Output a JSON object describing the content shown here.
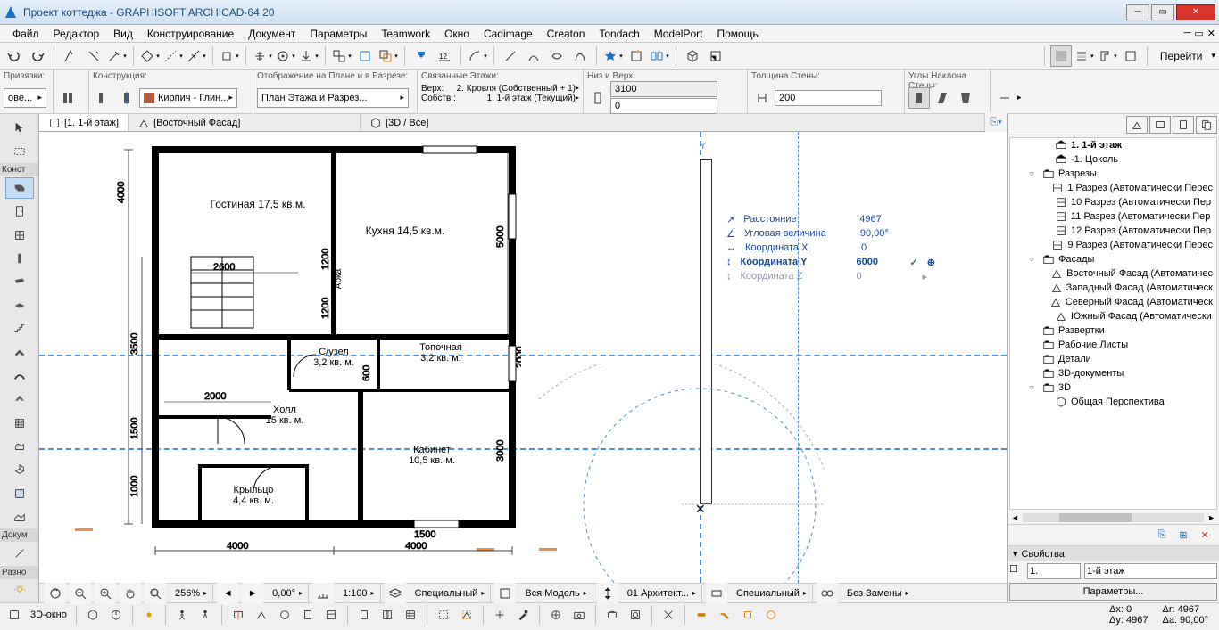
{
  "title": "Проект коттеджа - GRAPHISOFT ARCHICAD-64 20",
  "menus": [
    "Файл",
    "Редактор",
    "Вид",
    "Конструирование",
    "Документ",
    "Параметры",
    "Teamwork",
    "Окно",
    "Cadimage",
    "Creaton",
    "Tondach",
    "ModelPort",
    "Помощь"
  ],
  "nav_link": "Перейти",
  "infobox": {
    "snaps": {
      "label": "Привязки:",
      "value": "ове..."
    },
    "construction": {
      "label": "Конструкция:",
      "value": "Кирпич - Глин..."
    },
    "display": {
      "label": "Отображение на Плане и в Разрезе:",
      "value": "План Этажа и Разрез..."
    },
    "linked_stories": {
      "label": "Связанные Этажи:",
      "top": "Верх:",
      "top_val": "2. Кровля (Собственный + 1)",
      "own": "Собств.:",
      "own_val": "1. 1-й этаж (Текущий)"
    },
    "top_bottom": {
      "label": "Низ и Верх:",
      "top": "3100",
      "bottom": "0"
    },
    "thickness": {
      "label": "Толщина Стены:",
      "value": "200"
    },
    "angles": {
      "label": "Углы Наклона Стены:"
    }
  },
  "tabs": [
    {
      "label": "[1. 1-й этаж]",
      "active": true
    },
    {
      "label": "[Восточный Фасад]",
      "active": false
    },
    {
      "label": "[3D / Все]",
      "active": false
    }
  ],
  "tracker": {
    "distance": {
      "label": "Расстояние",
      "value": "4967"
    },
    "angle": {
      "label": "Угловая величина",
      "value": "90,00°"
    },
    "x": {
      "label": "Координата X",
      "value": "0"
    },
    "y": {
      "label": "Координата Y",
      "value": "6000"
    },
    "z": {
      "label": "Координата Z",
      "value": "0"
    }
  },
  "plan": {
    "rooms": {
      "living": "Гостиная 17,5 кв.м.",
      "kitchen": "Кухня 14,5 кв.м.",
      "arch": "Арка",
      "bath": "С/узел\n3,2 кв. м.",
      "boiler": "Топочная\n3,2 кв. м.",
      "hall": "Холл\n15 кв. м.",
      "office": "Кабинет\n10,5 кв. м.",
      "porch": "Крыльцо\n4,4 кв. м."
    },
    "dims": {
      "d2600": "2600",
      "d4000a": "4000",
      "d4000b": "4000",
      "d4000c": "4000",
      "d3500": "3500",
      "d1500a": "1500",
      "d1500b": "1500",
      "d1000": "1000",
      "d1200a": "1200",
      "d1200b": "1200",
      "d2000a": "2000",
      "d2000b": "2000",
      "d600": "600",
      "d5000": "5000",
      "d3000": "3000"
    }
  },
  "navigator": {
    "items": [
      {
        "indent": 2,
        "icon": "story",
        "label": "1. 1-й этаж",
        "bold": true
      },
      {
        "indent": 2,
        "icon": "story",
        "label": "-1. Цоколь"
      },
      {
        "indent": 1,
        "exp": "▿",
        "icon": "folder",
        "label": "Разрезы"
      },
      {
        "indent": 2,
        "icon": "section",
        "label": "1 Разрез (Автоматически Перес"
      },
      {
        "indent": 2,
        "icon": "section",
        "label": "10 Разрез (Автоматически Пер"
      },
      {
        "indent": 2,
        "icon": "section",
        "label": "11 Разрез (Автоматически Пер"
      },
      {
        "indent": 2,
        "icon": "section",
        "label": "12 Разрез (Автоматически Пер"
      },
      {
        "indent": 2,
        "icon": "section",
        "label": "9 Разрез (Автоматически Перес"
      },
      {
        "indent": 1,
        "exp": "▿",
        "icon": "folder",
        "label": "Фасады"
      },
      {
        "indent": 2,
        "icon": "elev",
        "label": "Восточный Фасад (Автоматичес"
      },
      {
        "indent": 2,
        "icon": "elev",
        "label": "Западный Фасад (Автоматическ"
      },
      {
        "indent": 2,
        "icon": "elev",
        "label": "Северный Фасад (Автоматическ"
      },
      {
        "indent": 2,
        "icon": "elev",
        "label": "Южный Фасад (Автоматически"
      },
      {
        "indent": 1,
        "icon": "folder",
        "label": "Развертки"
      },
      {
        "indent": 1,
        "icon": "folder",
        "label": "Рабочие Листы"
      },
      {
        "indent": 1,
        "icon": "folder",
        "label": "Детали"
      },
      {
        "indent": 1,
        "icon": "folder",
        "label": "3D-документы"
      },
      {
        "indent": 1,
        "exp": "▿",
        "icon": "folder",
        "label": "3D"
      },
      {
        "indent": 2,
        "icon": "3d",
        "label": "Общая Перспектива"
      }
    ],
    "props": {
      "header": "Свойства",
      "id": "1.",
      "name": "1-й этаж",
      "settings": "Параметры..."
    }
  },
  "quickbar": {
    "zoom": "256%",
    "angle": "0,00°",
    "scale": "1:100",
    "special1": "Специальный",
    "model": "Вся Модель",
    "layerset": "01 Архитект...",
    "special2": "Специальный",
    "overrides": "Без Замены"
  },
  "status": {
    "view3d": "3D-окно",
    "dx": "Δx: 0",
    "dy": "Δy: 4967",
    "dr": "Δr: 4967",
    "da": "Δa: 90,00°"
  },
  "toolbox": {
    "cat1": "Конст",
    "cat2": "Докум",
    "cat3": "Разно"
  }
}
